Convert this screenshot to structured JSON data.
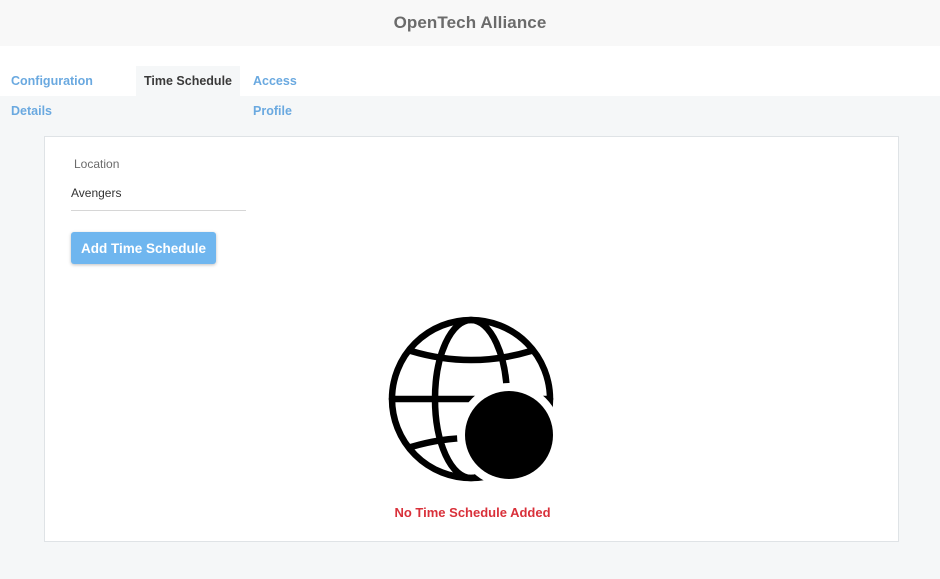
{
  "header": {
    "title": "OpenTech Alliance"
  },
  "tabs": [
    {
      "label": "Configuration Details",
      "active": false
    },
    {
      "label": "Time Schedule",
      "active": true
    },
    {
      "label": "Access Profile",
      "active": false
    }
  ],
  "form": {
    "location_label": "Location",
    "location_value": "Avengers"
  },
  "actions": {
    "add_label": "Add Time Schedule"
  },
  "empty_state": {
    "icon": "globe-icon",
    "message": "No Time Schedule Added"
  },
  "colors": {
    "accent": "#6fb6ef",
    "tab_link": "#6aa9e0",
    "error": "#d9303a",
    "background": "#f5f7f8"
  }
}
